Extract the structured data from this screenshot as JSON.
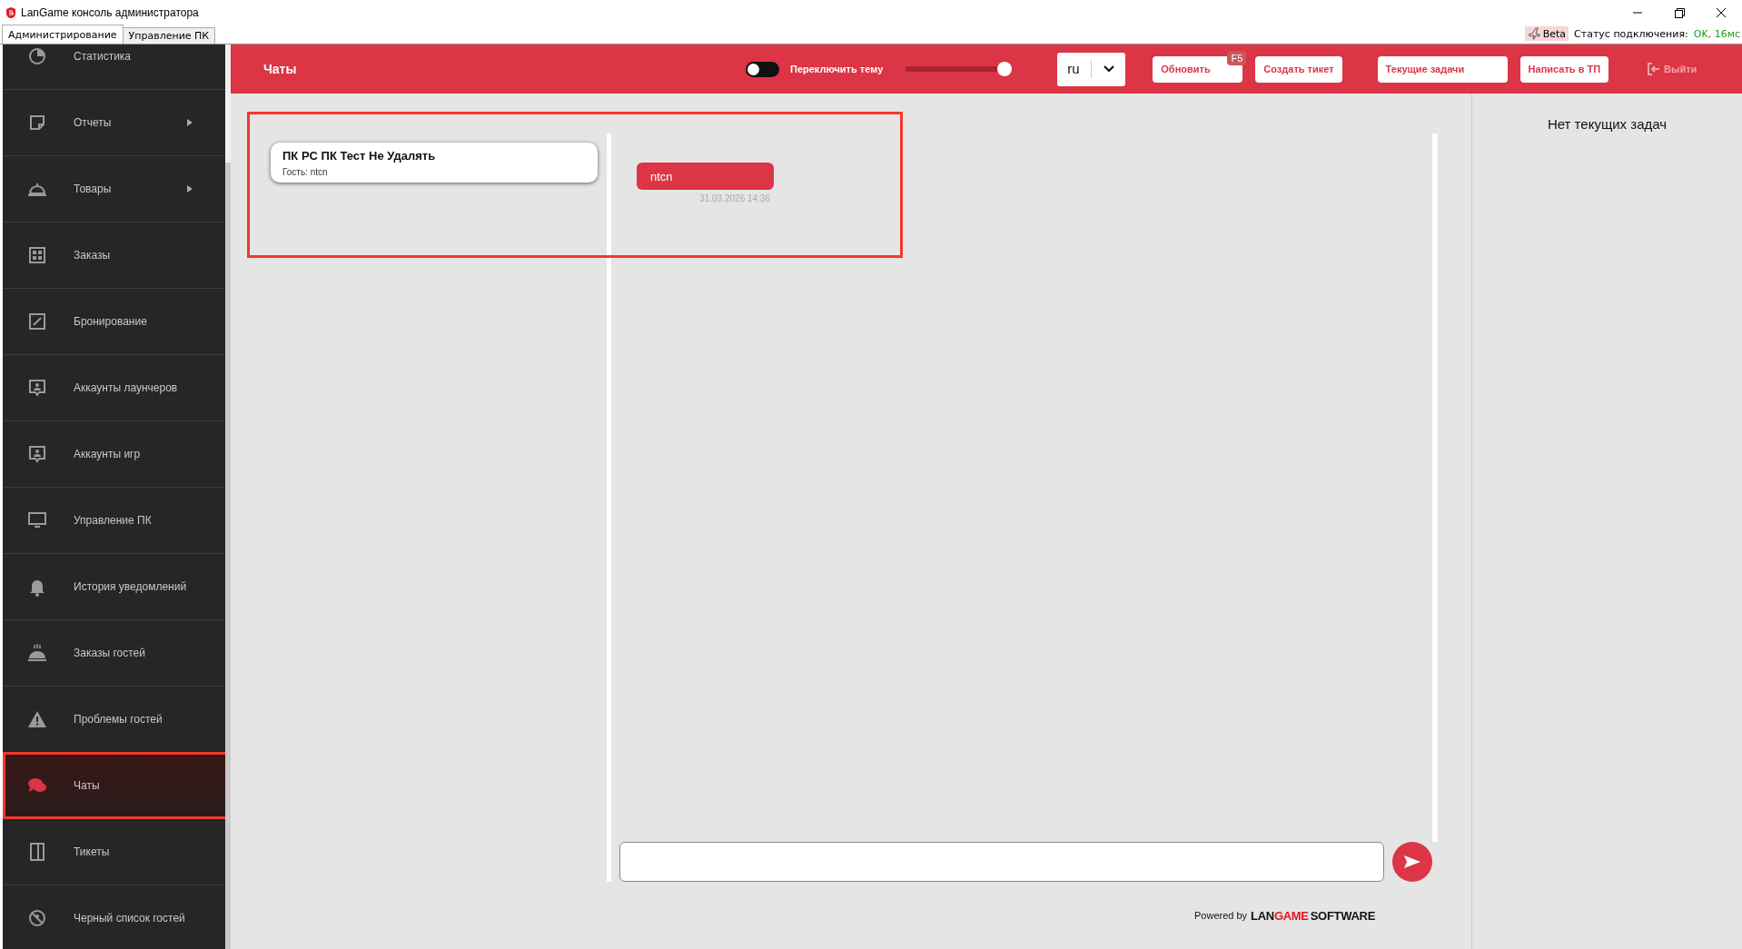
{
  "window": {
    "title": "LanGame консоль администратора"
  },
  "tabs": [
    {
      "label": "Администрирование",
      "selected": true
    },
    {
      "label": "Управление ПК",
      "selected": false
    }
  ],
  "status": {
    "beta": "Beta",
    "label": "Статус подключения:",
    "value": "OK, 16мс"
  },
  "sidebar": {
    "items": [
      {
        "label": "Статистика",
        "selected": false,
        "has_submenu": false
      },
      {
        "label": "Отчеты",
        "selected": false,
        "has_submenu": true
      },
      {
        "label": "Товары",
        "selected": false,
        "has_submenu": true
      },
      {
        "label": "Заказы",
        "selected": false,
        "has_submenu": false
      },
      {
        "label": "Бронирование",
        "selected": false,
        "has_submenu": false
      },
      {
        "label": "Аккаунты лаунчеров",
        "selected": false,
        "has_submenu": false
      },
      {
        "label": "Аккаунты игр",
        "selected": false,
        "has_submenu": false
      },
      {
        "label": "Управление ПК",
        "selected": false,
        "has_submenu": false
      },
      {
        "label": "История уведомлений",
        "selected": false,
        "has_submenu": false
      },
      {
        "label": "Заказы гостей",
        "selected": false,
        "has_submenu": false
      },
      {
        "label": "Проблемы гостей",
        "selected": false,
        "has_submenu": false
      },
      {
        "label": "Чаты",
        "selected": true,
        "has_submenu": false
      },
      {
        "label": "Тикеты",
        "selected": false,
        "has_submenu": false
      },
      {
        "label": "Черный список гостей",
        "selected": false,
        "has_submenu": false
      }
    ]
  },
  "header": {
    "title": "Чаты",
    "theme_toggle": {
      "label": "Переключить тему",
      "on": false
    },
    "slider": {
      "level": 0.92
    },
    "language": {
      "value": "ru"
    },
    "buttons": [
      {
        "label": "Обновить",
        "shortcut": "F5"
      },
      {
        "label": "Создать тикет"
      },
      {
        "label": "Текущие задачи"
      },
      {
        "label": "Написать в ТП"
      }
    ],
    "logout": {
      "label": "Выйти",
      "disabled": true
    }
  },
  "chats": [
    {
      "title": "ПК PC ПК Тест Не Удалять",
      "subtitle": "Гость: ntcn"
    }
  ],
  "messages": [
    {
      "text": "ntcn",
      "time": "31.03.2026 14:36"
    }
  ],
  "tasks_panel": {
    "empty_text": "Нет текущих задач"
  },
  "footer": {
    "powered_by": "Powered by",
    "logo": [
      {
        "text": "LAN",
        "kind": "dark"
      },
      {
        "text": "GAME",
        "kind": "accent"
      },
      {
        "text": "SOFTWARE",
        "kind": "dark"
      }
    ]
  }
}
